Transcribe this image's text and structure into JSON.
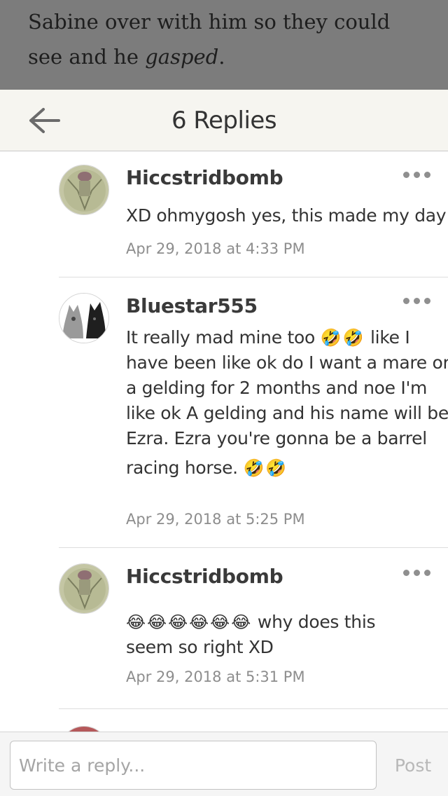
{
  "story": {
    "line1": "Sabine over with him so they could",
    "line2_before": "see and he ",
    "line2_em": "gasped",
    "line2_after": "."
  },
  "header": {
    "title": "6 Replies",
    "back_icon": "arrow-left-icon"
  },
  "replies": [
    {
      "username": "Hiccstridbomb",
      "text_lines": [
        "XD ohmygosh yes, this made my day"
      ],
      "timestamp": "Apr 29, 2018 at 4:33 PM"
    },
    {
      "username": "Bluestar555",
      "text_lines": [
        "It really mad mine too",
        "🤣🤣",
        "like I",
        "have been like ok do I want a mare or",
        "a gelding for 2 months and noe I'm",
        "like ok A gelding and his name will be",
        "Ezra. Ezra you're gonna be a barrel",
        "racing horse.",
        "🤣🤣"
      ],
      "timestamp": "Apr 29, 2018 at 5:25 PM"
    },
    {
      "username": "Hiccstridbomb",
      "text_lines": [
        "😂😂😂😂😂😂",
        "why does this",
        "seem so right XD"
      ],
      "timestamp": "Apr 29, 2018 at 5:31 PM"
    }
  ],
  "reply_bar": {
    "placeholder": "Write a reply...",
    "post_label": "Post"
  },
  "colors": {
    "header_bg": "#f6f5f0",
    "story_bg": "#7c7c7c",
    "timestamp": "#8d8d8d",
    "divider": "#dddddd"
  }
}
